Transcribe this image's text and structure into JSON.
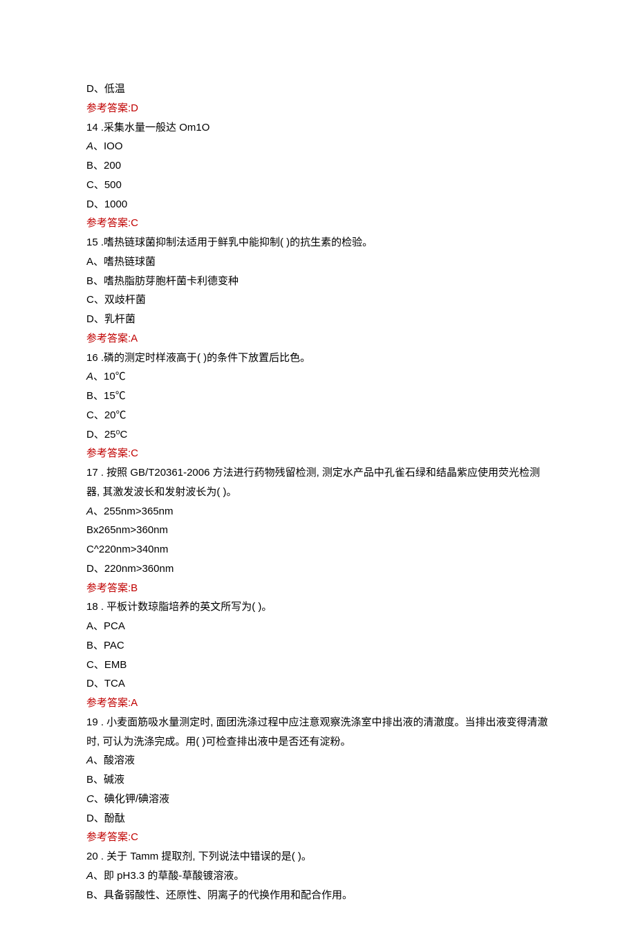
{
  "lines": [
    {
      "text": "D、低温",
      "type": "option"
    },
    {
      "text": "参考答案:D",
      "type": "answer"
    },
    {
      "text": "14  .采集水量一般达 Om1O",
      "type": "question"
    },
    {
      "text": "A、IOO",
      "type": "option-italic"
    },
    {
      "text": "B、200",
      "type": "option"
    },
    {
      "text": "C、500",
      "type": "option"
    },
    {
      "text": "D、1000",
      "type": "option"
    },
    {
      "text": "参考答案:C",
      "type": "answer"
    },
    {
      "text": "15  .嗜热链球菌抑制法适用于鲜乳中能抑制( )的抗生素的检验。",
      "type": "question"
    },
    {
      "text": "A、嗜热链球菌",
      "type": "option"
    },
    {
      "text": "B、嗜热脂肪芽胞杆菌卡利德变种",
      "type": "option"
    },
    {
      "text": "C、双歧杆菌",
      "type": "option"
    },
    {
      "text": "D、乳杆菌",
      "type": "option"
    },
    {
      "text": "参考答案:A",
      "type": "answer"
    },
    {
      "text": "16  .磷的测定时样液高于( )的条件下放置后比色。",
      "type": "question"
    },
    {
      "text": "A、10℃",
      "type": "option-italic"
    },
    {
      "text": "B、15℃",
      "type": "option"
    },
    {
      "text": "C、20℃",
      "type": "option"
    },
    {
      "text": "D、25⁰C",
      "type": "option"
    },
    {
      "text": "参考答案:C",
      "type": "answer"
    },
    {
      "text": "17  . 按照 GB/T20361-2006 方法进行药物残留检测, 测定水产品中孔雀石绿和结晶紫应使用荧光检测器, 其激发波长和发射波长为( )。",
      "type": "question"
    },
    {
      "text": "A、255nm>365nm",
      "type": "option-italic"
    },
    {
      "text": "Bx265nm>360nm",
      "type": "option"
    },
    {
      "text": "C^220nm>340nm",
      "type": "option"
    },
    {
      "text": "D、220nm>360nm",
      "type": "option"
    },
    {
      "text": "参考答案:B",
      "type": "answer"
    },
    {
      "text": "18  . 平板计数琼脂培养的英文所写为( )。",
      "type": "question"
    },
    {
      "text": "A、PCA",
      "type": "option"
    },
    {
      "text": "B、PAC",
      "type": "option"
    },
    {
      "text": "C、EMB",
      "type": "option"
    },
    {
      "text": "D、TCA",
      "type": "option"
    },
    {
      "text": "参考答案:A",
      "type": "answer"
    },
    {
      "text": "19  . 小麦面筋吸水量测定时, 面团洗涤过程中应注意观察洗涤室中排出液的清澈度。当排出液变得清澈时, 可认为洗涤完成。用( )可检查排出液中是否还有淀粉。",
      "type": "question"
    },
    {
      "text": "A、酸溶液",
      "type": "option-italic"
    },
    {
      "text": "B、碱液",
      "type": "option"
    },
    {
      "text": "C、碘化钾/碘溶液",
      "type": "option-italic"
    },
    {
      "text": "D、酚酞",
      "type": "option"
    },
    {
      "text": "参考答案:C",
      "type": "answer"
    },
    {
      "text": "20  . 关于 Tamm 提取剂, 下列说法中错误的是( )。",
      "type": "question"
    },
    {
      "text": "A、即 pH3.3 的草酸-草酸镀溶液。",
      "type": "option-italic"
    },
    {
      "text": "B、具备弱酸性、还原性、阴离子的代换作用和配合作用。",
      "type": "option"
    }
  ]
}
